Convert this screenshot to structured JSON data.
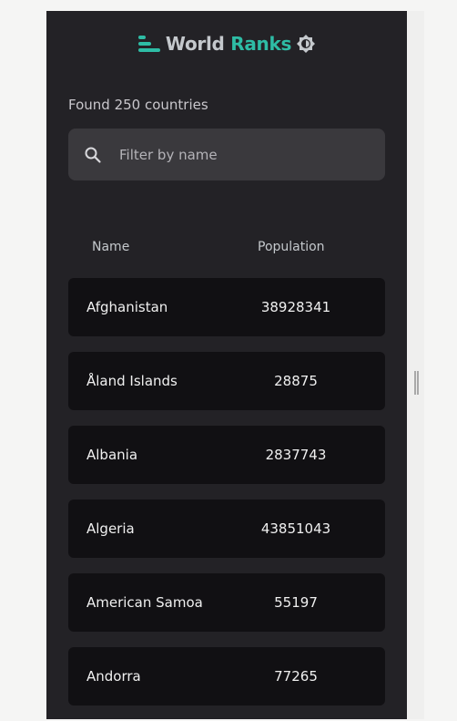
{
  "header": {
    "title_part1": "World",
    "title_part2": "Ranks",
    "logo_icon": "bar-list-icon",
    "theme_icon": "brightness-icon",
    "accent_color": "#2ebca5"
  },
  "results": {
    "count_text": "Found 250 countries"
  },
  "search": {
    "placeholder": "Filter by name",
    "value": "",
    "icon": "search-icon"
  },
  "table": {
    "headers": [
      "Name",
      "Population"
    ],
    "rows": [
      {
        "name": "Afghanistan",
        "population": "38928341"
      },
      {
        "name": "Åland Islands",
        "population": "28875"
      },
      {
        "name": "Albania",
        "population": "2837743"
      },
      {
        "name": "Algeria",
        "population": "43851043"
      },
      {
        "name": "American Samoa",
        "population": "55197"
      },
      {
        "name": "Andorra",
        "population": "77265"
      }
    ]
  }
}
